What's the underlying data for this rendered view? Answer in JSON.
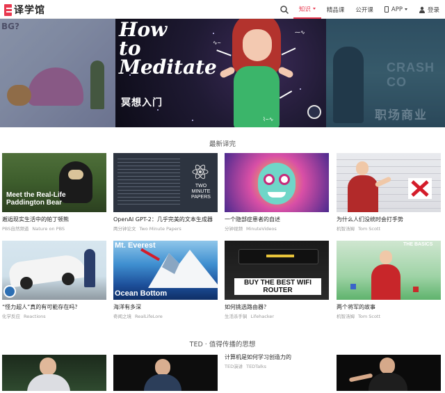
{
  "header": {
    "logo_text": "译学馆",
    "nav": [
      {
        "label": "知识",
        "active": true,
        "has_caret": true
      },
      {
        "label": "精品课"
      },
      {
        "label": "公开课"
      },
      {
        "label": "APP",
        "has_caret": true
      },
      {
        "label": "登录"
      }
    ]
  },
  "banner": {
    "left_text": "BG?",
    "main_title_line1": "How",
    "main_title_line2": "to",
    "main_title_line3": "Meditate",
    "main_subtitle": "冥想入门",
    "right_text_top": "CRASH CO",
    "right_text_bottom": "职场商业"
  },
  "sections": {
    "latest_title": "最新译完",
    "ted_title": "TED · 值得传播的思想"
  },
  "latest_cards": [
    {
      "title": "邂逅现实生活中的帕丁顿熊",
      "category": "PBS自然频道",
      "source": "Nature on PBS",
      "overlay": "Meet the Real-Life Paddington Bear"
    },
    {
      "title": "OpenAI GPT-2：几乎完美的文本生成器",
      "category": "两分钟论文",
      "source": "Two Minute Papers",
      "overlay": "TWO MINUTE PAPERS"
    },
    {
      "title": "一个隐部症患者的自述",
      "category": "分钟视频",
      "source": "MinuteVideos",
      "overlay": ""
    },
    {
      "title": "为什么人们没统时会打手势",
      "category": "机智汤姆",
      "source": "Tom Scott",
      "overlay": ""
    },
    {
      "title": "“怪力超人”真的有可能存在吗？",
      "category": "化学反应",
      "source": "Reactions",
      "overlay": ""
    },
    {
      "title": "海洋有多深",
      "category": "奇闻之境",
      "source": "RealLifeLore",
      "overlay_top": "Mt. Everest",
      "overlay_bottom": "Ocean Bottom"
    },
    {
      "title": "如何挑选路由器？",
      "category": "生活杀手锏",
      "source": "Lifehacker",
      "overlay": "BUY THE BEST WIFI ROUTER"
    },
    {
      "title": "两个将军的故事",
      "category": "机智汤姆",
      "source": "Tom Scott",
      "overlay": "THE BASICS"
    }
  ],
  "ted_cards": [
    {
      "title": ""
    },
    {
      "title": ""
    },
    {
      "title": "计算机是如何学习创造力的",
      "category": "TED演讲",
      "source": "TEDTalks"
    },
    {
      "title": ""
    }
  ]
}
